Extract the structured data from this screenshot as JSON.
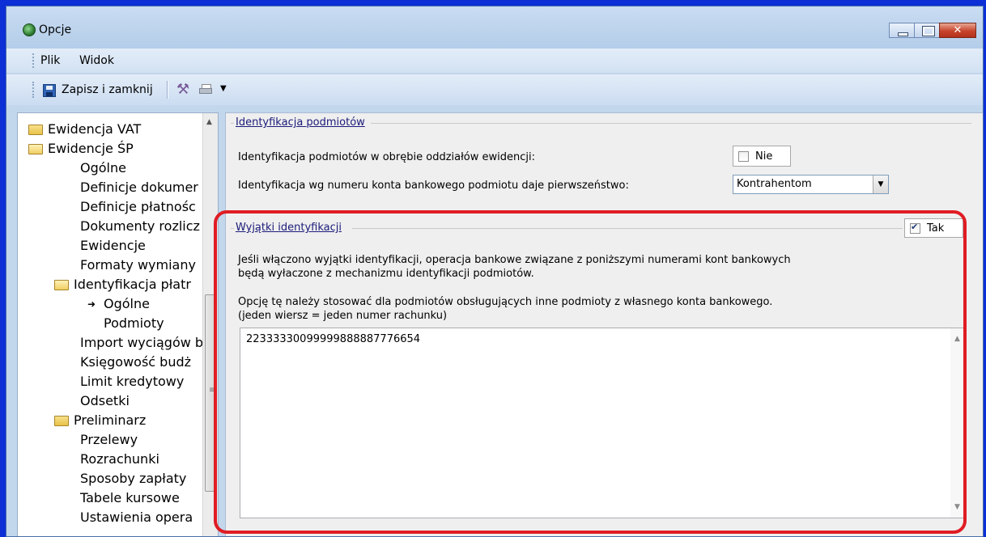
{
  "window": {
    "title": "Opcje"
  },
  "menu": {
    "items": [
      "Plik",
      "Widok"
    ]
  },
  "toolbar": {
    "save_label": "Zapisz i zamknij"
  },
  "tree": {
    "items": [
      {
        "label": "Ewidencja VAT",
        "icon": "folder-icon"
      },
      {
        "label": "Ewidencje ŚP",
        "icon": "folder-open-icon"
      },
      {
        "label": "Ogólne"
      },
      {
        "label": "Definicje dokumer"
      },
      {
        "label": "Definicje płatnośc"
      },
      {
        "label": "Dokumenty rozlicz"
      },
      {
        "label": "Ewidencje"
      },
      {
        "label": "Formaty wymiany"
      },
      {
        "label": "Identyfikacja płatr",
        "icon": "folder-open-icon"
      },
      {
        "label": "Ogólne",
        "selected": true
      },
      {
        "label": "Podmioty"
      },
      {
        "label": "Import wyciągów b"
      },
      {
        "label": "Księgowość budż"
      },
      {
        "label": "Limit kredytowy"
      },
      {
        "label": "Odsetki"
      },
      {
        "label": "Preliminarz",
        "icon": "folder-icon"
      },
      {
        "label": "Przelewy"
      },
      {
        "label": "Rozrachunki"
      },
      {
        "label": "Sposoby zapłaty"
      },
      {
        "label": "Tabele kursowe"
      },
      {
        "label": "Ustawienia opera"
      }
    ]
  },
  "identyfikacja": {
    "legend": "Identyfikacja podmiotów",
    "row1_label": "Identyfikacja podmiotów w obrębie oddziałów ewidencji:",
    "row1_check_label": "Nie",
    "row2_label": "Identyfikacja wg numeru konta bankowego podmiotu daje pierwszeństwo:",
    "row2_value": "Kontrahentom"
  },
  "wyjatki": {
    "legend": "Wyjątki identyfikacji",
    "check_label": "Tak",
    "desc1": "Jeśli włączono wyjątki identyfikacji, operacja bankowe związane z poniższymi numerami kont bankowych",
    "desc2": "będą wyłaczone z mechanizmu identyfikacji podmiotów.",
    "desc3": "Opcję tę należy stosować dla podmiotów obsługujących inne podmioty z własnego konta bankowego.",
    "desc4": "(jeden wiersz = jeden numer rachunku)",
    "textarea_value": "22333330099999888887776654"
  },
  "colors": {
    "highlight": "#e01c23",
    "desktop": "#0c2fd6"
  }
}
